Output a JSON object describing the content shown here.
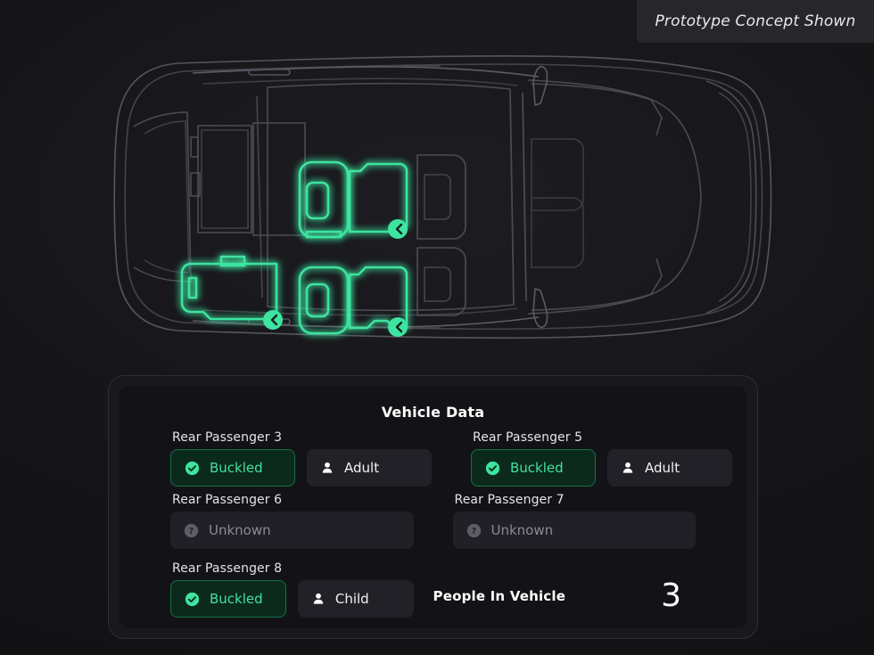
{
  "badge": {
    "text": "Prototype Concept Shown"
  },
  "diagram": {
    "name": "vehicle-top-down-seating-diagram",
    "highlight_color": "#3ee4a0",
    "outline_color": "#5a5a62",
    "seats": [
      {
        "id": "rear-passenger-3",
        "label": "Rear Passenger 3",
        "state": "buckled",
        "badge": "seatbelt-icon"
      },
      {
        "id": "rear-passenger-5",
        "label": "Rear Passenger 5",
        "state": "buckled",
        "badge": "seatbelt-icon"
      },
      {
        "id": "rear-passenger-8",
        "label": "Rear Passenger 8",
        "state": "buckled",
        "badge": "seatbelt-icon"
      }
    ]
  },
  "panel": {
    "title": "Vehicle Data",
    "passengers": [
      {
        "label": "Rear Passenger 3",
        "belt": {
          "text": "Buckled",
          "icon": "check-circle-icon",
          "state": "buckled"
        },
        "occupant": {
          "text": "Adult",
          "icon": "person-icon"
        }
      },
      {
        "label": "Rear Passenger 5",
        "belt": {
          "text": "Buckled",
          "icon": "check-circle-icon",
          "state": "buckled"
        },
        "occupant": {
          "text": "Adult",
          "icon": "person-icon"
        }
      },
      {
        "label": "Rear Passenger 6",
        "belt": {
          "text": "Unknown",
          "icon": "question-circle-icon",
          "state": "unknown"
        }
      },
      {
        "label": "Rear Passenger 7",
        "belt": {
          "text": "Unknown",
          "icon": "question-circle-icon",
          "state": "unknown"
        }
      },
      {
        "label": "Rear Passenger 8",
        "belt": {
          "text": "Buckled",
          "icon": "check-circle-icon",
          "state": "buckled"
        },
        "occupant": {
          "text": "Child",
          "icon": "person-icon"
        }
      }
    ],
    "people_in_vehicle": {
      "label": "People In Vehicle",
      "value": "3"
    }
  },
  "colors": {
    "background": "#131316",
    "panel": "#19191d",
    "panel_inner": "#131317",
    "accent_green": "#3ee4a0",
    "buckled_bg": "#0b2a1c",
    "buckled_border": "#17704a",
    "chip_bg": "#212127",
    "muted_text": "#8a8a93",
    "badge_bg": "#26262b"
  }
}
